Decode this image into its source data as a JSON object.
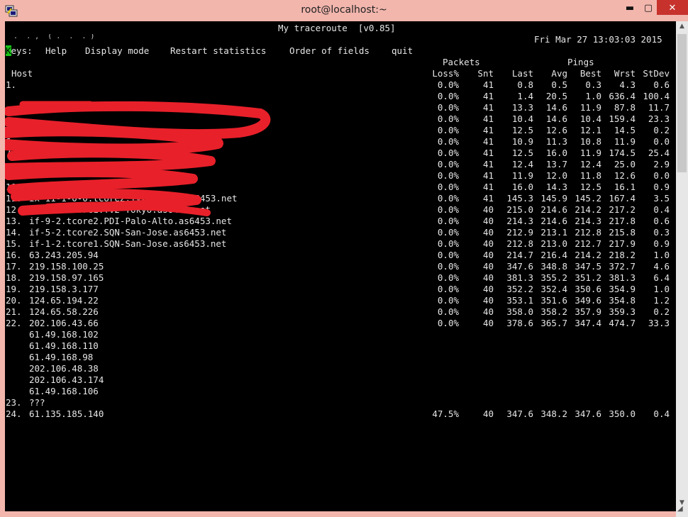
{
  "window": {
    "title": "root@localhost:~",
    "minimize": "▬",
    "maximize": "▢",
    "close": "✕"
  },
  "header": {
    "prog": "My traceroute  [v0.85]",
    "partial_host": "  .  . ,  ( .  .  . )",
    "datetime": "Fri Mar 27 13:03:03 2015",
    "keys_cursor": "K",
    "keys_label": "eys:",
    "keys": [
      "Help",
      "Display mode",
      "Restart statistics",
      "Order of fields",
      "quit"
    ]
  },
  "columns": {
    "group_packets": "Packets",
    "group_pings": "Pings",
    "host": "Host",
    "loss": "Loss%",
    "snt": "Snt",
    "last": "Last",
    "avg": "Avg",
    "best": "Best",
    "wrst": "Wrst",
    "stdev": "StDev"
  },
  "rows": [
    {
      "n": "1.",
      "host": "",
      "loss": "0.0%",
      "snt": "41",
      "last": "0.8",
      "avg": "0.5",
      "best": "0.3",
      "wrst": "4.3",
      "stdev": "0.6"
    },
    {
      "n": "",
      "host": "",
      "loss": "0.0%",
      "snt": "41",
      "last": "1.4",
      "avg": "20.5",
      "best": "1.0",
      "wrst": "636.4",
      "stdev": "100.4"
    },
    {
      "n": "",
      "host": "",
      "loss": "0.0%",
      "snt": "41",
      "last": "13.3",
      "avg": "14.6",
      "best": "11.9",
      "wrst": "87.8",
      "stdev": "11.7"
    },
    {
      "n": "",
      "host": "",
      "loss": "0.0%",
      "snt": "41",
      "last": "10.4",
      "avg": "14.6",
      "best": "10.4",
      "wrst": "159.4",
      "stdev": "23.3"
    },
    {
      "n": "",
      "host": "",
      "loss": "0.0%",
      "snt": "41",
      "last": "12.5",
      "avg": "12.6",
      "best": "12.1",
      "wrst": "14.5",
      "stdev": "0.2"
    },
    {
      "n": "6.",
      "host": "",
      "loss": "0.0%",
      "snt": "41",
      "last": "10.9",
      "avg": "11.3",
      "best": "10.8",
      "wrst": "11.9",
      "stdev": "0.0"
    },
    {
      "n": "7.",
      "host": "",
      "loss": "0.0%",
      "snt": "41",
      "last": "12.5",
      "avg": "16.0",
      "best": "11.9",
      "wrst": "174.5",
      "stdev": "25.4"
    },
    {
      "n": "",
      "host": "",
      "loss": "0.0%",
      "snt": "41",
      "last": "12.4",
      "avg": "13.7",
      "best": "12.4",
      "wrst": "25.0",
      "stdev": "2.9"
    },
    {
      "n": "",
      "host": "",
      "loss": "0.0%",
      "snt": "41",
      "last": "11.9",
      "avg": "12.0",
      "best": "11.8",
      "wrst": "12.6",
      "stdev": "0.0"
    },
    {
      "n": "10.",
      "host": "",
      "loss": "0.0%",
      "snt": "41",
      "last": "16.0",
      "avg": "14.3",
      "best": "12.5",
      "wrst": "16.1",
      "stdev": "0.9"
    },
    {
      "n": "11.",
      "host": "ix-11-1-0-0.tcore2.TV2-Tokyo.as6453.net",
      "loss": "0.0%",
      "snt": "41",
      "last": "145.3",
      "avg": "145.9",
      "best": "145.2",
      "wrst": "167.4",
      "stdev": "3.5"
    },
    {
      "n": "12.",
      "host": "if-2-2.tcore1.TV2-Tokyo.as6453.net",
      "loss": "0.0%",
      "snt": "40",
      "last": "215.0",
      "avg": "214.6",
      "best": "214.2",
      "wrst": "217.2",
      "stdev": "0.4"
    },
    {
      "n": "13.",
      "host": "if-9-2.tcore2.PDI-Palo-Alto.as6453.net",
      "loss": "0.0%",
      "snt": "40",
      "last": "214.3",
      "avg": "214.6",
      "best": "214.3",
      "wrst": "217.8",
      "stdev": "0.6"
    },
    {
      "n": "14.",
      "host": "if-5-2.tcore2.SQN-San-Jose.as6453.net",
      "loss": "0.0%",
      "snt": "40",
      "last": "212.9",
      "avg": "213.1",
      "best": "212.8",
      "wrst": "215.8",
      "stdev": "0.3"
    },
    {
      "n": "15.",
      "host": "if-1-2.tcore1.SQN-San-Jose.as6453.net",
      "loss": "0.0%",
      "snt": "40",
      "last": "212.8",
      "avg": "213.0",
      "best": "212.7",
      "wrst": "217.9",
      "stdev": "0.9"
    },
    {
      "n": "16.",
      "host": "63.243.205.94",
      "loss": "0.0%",
      "snt": "40",
      "last": "214.7",
      "avg": "216.4",
      "best": "214.2",
      "wrst": "218.2",
      "stdev": "1.0"
    },
    {
      "n": "17.",
      "host": "219.158.100.25",
      "loss": "0.0%",
      "snt": "40",
      "last": "347.6",
      "avg": "348.8",
      "best": "347.5",
      "wrst": "372.7",
      "stdev": "4.6"
    },
    {
      "n": "18.",
      "host": "219.158.97.165",
      "loss": "0.0%",
      "snt": "40",
      "last": "381.3",
      "avg": "355.2",
      "best": "351.2",
      "wrst": "381.3",
      "stdev": "6.4"
    },
    {
      "n": "19.",
      "host": "219.158.3.177",
      "loss": "0.0%",
      "snt": "40",
      "last": "352.2",
      "avg": "352.4",
      "best": "350.6",
      "wrst": "354.9",
      "stdev": "1.0"
    },
    {
      "n": "20.",
      "host": "124.65.194.22",
      "loss": "0.0%",
      "snt": "40",
      "last": "353.1",
      "avg": "351.6",
      "best": "349.6",
      "wrst": "354.8",
      "stdev": "1.2"
    },
    {
      "n": "21.",
      "host": "124.65.58.226",
      "loss": "0.0%",
      "snt": "40",
      "last": "358.0",
      "avg": "358.2",
      "best": "357.9",
      "wrst": "359.3",
      "stdev": "0.2"
    },
    {
      "n": "22.",
      "host": "202.106.43.66",
      "loss": "0.0%",
      "snt": "40",
      "last": "378.6",
      "avg": "365.7",
      "best": "347.4",
      "wrst": "474.7",
      "stdev": "33.3"
    },
    {
      "n": "",
      "host": "61.49.168.102",
      "loss": "",
      "snt": "",
      "last": "",
      "avg": "",
      "best": "",
      "wrst": "",
      "stdev": ""
    },
    {
      "n": "",
      "host": "61.49.168.110",
      "loss": "",
      "snt": "",
      "last": "",
      "avg": "",
      "best": "",
      "wrst": "",
      "stdev": ""
    },
    {
      "n": "",
      "host": "61.49.168.98",
      "loss": "",
      "snt": "",
      "last": "",
      "avg": "",
      "best": "",
      "wrst": "",
      "stdev": ""
    },
    {
      "n": "",
      "host": "202.106.48.38",
      "loss": "",
      "snt": "",
      "last": "",
      "avg": "",
      "best": "",
      "wrst": "",
      "stdev": ""
    },
    {
      "n": "",
      "host": "202.106.43.174",
      "loss": "",
      "snt": "",
      "last": "",
      "avg": "",
      "best": "",
      "wrst": "",
      "stdev": ""
    },
    {
      "n": "",
      "host": "61.49.168.106",
      "loss": "",
      "snt": "",
      "last": "",
      "avg": "",
      "best": "",
      "wrst": "",
      "stdev": ""
    },
    {
      "n": "23.",
      "host": "???",
      "loss": "",
      "snt": "",
      "last": "",
      "avg": "",
      "best": "",
      "wrst": "",
      "stdev": ""
    },
    {
      "n": "24.",
      "host": "61.135.185.140",
      "loss": "47.5%",
      "snt": "40",
      "last": "347.6",
      "avg": "348.2",
      "best": "347.6",
      "wrst": "350.0",
      "stdev": "0.4"
    }
  ],
  "colors": {
    "titlebar": "#f2b6ad",
    "cursor": "#18c418",
    "redaction": "#e8202a",
    "close_button": "#c7322c"
  }
}
